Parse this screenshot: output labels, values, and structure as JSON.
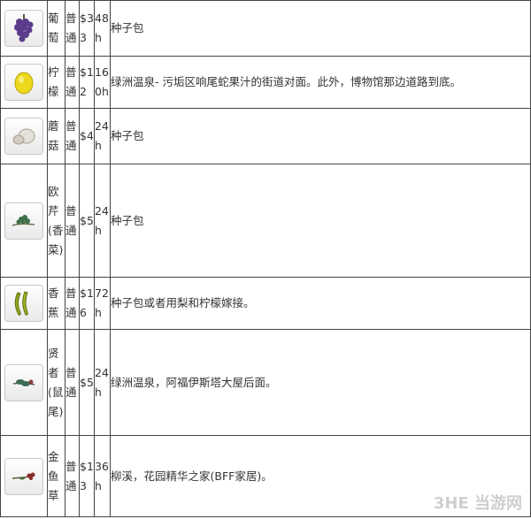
{
  "rows": [
    {
      "name": "葡萄",
      "type": "普通",
      "price": "$33",
      "time": "48h",
      "source": "种子包",
      "icon": "grape-icon",
      "color": "#5a3a8a"
    },
    {
      "name": "柠檬",
      "type": "普通",
      "price": "$12",
      "time": "160h",
      "source": "绿洲温泉- 污垢区响尾蛇果汁的街道对面。此外，博物馆那边道路到底。",
      "icon": "lemon-icon",
      "color": "#e6d21a"
    },
    {
      "name": "蘑菇",
      "type": "普通",
      "price": "$4",
      "time": "24h",
      "source": "种子包",
      "icon": "mushroom-icon",
      "color": "#d8d2c8"
    },
    {
      "name": "欧芹(香菜)",
      "type": "普通",
      "price": "$5",
      "time": "24h",
      "source": "种子包",
      "icon": "parsley-icon",
      "color": "#3f6e45"
    },
    {
      "name": "香蕉",
      "type": "普通",
      "price": "$16",
      "time": "72h",
      "source": "种子包或者用梨和柠檬嫁接。",
      "icon": "banana-icon",
      "color": "#8aa21c"
    },
    {
      "name": "贤者(鼠尾)",
      "type": "普通",
      "price": "$5",
      "time": "24h",
      "source": "绿洲温泉，阿福伊斯塔大屋后面。",
      "icon": "sage-icon",
      "color": "#3c6a52"
    },
    {
      "name": "金鱼草",
      "type": "普通",
      "price": "$13",
      "time": "36h",
      "source": "柳溪，花园精华之家(BFF家居)。",
      "icon": "snapdragon-icon",
      "color": "#8a2a2a"
    }
  ],
  "watermark": "3HE 当游网"
}
